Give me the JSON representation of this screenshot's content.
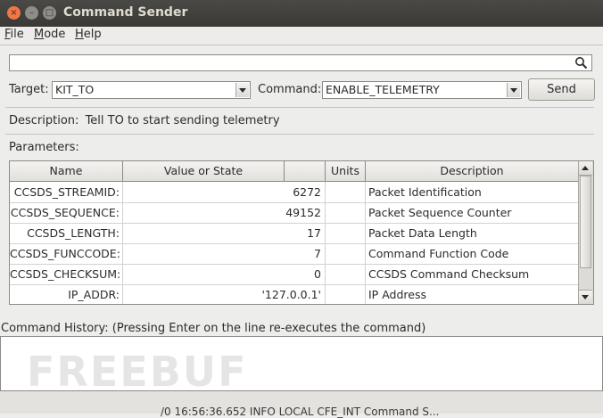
{
  "window": {
    "title": "Command Sender",
    "close_glyph": "×",
    "min_glyph": "–",
    "max_glyph": "□"
  },
  "menu": [
    {
      "key": "F",
      "rest": "ile"
    },
    {
      "key": "M",
      "rest": "ode"
    },
    {
      "key": "H",
      "rest": "elp"
    }
  ],
  "search": {
    "value": "",
    "icon": "search-icon"
  },
  "target": {
    "label": "Target:",
    "value": "KIT_TO"
  },
  "command": {
    "label": "Command:",
    "value": "ENABLE_TELEMETRY"
  },
  "send_label": "Send",
  "description": {
    "label": "Description:",
    "text": "Tell TO to start sending telemetry"
  },
  "parameters_label": "Parameters:",
  "table": {
    "headers": {
      "name": "Name",
      "value": "Value or State",
      "units": "Units",
      "description": "Description"
    },
    "rows": [
      {
        "name": "CCSDS_STREAMID:",
        "value": "6272",
        "units": "",
        "description": "Packet Identification"
      },
      {
        "name": "CCSDS_SEQUENCE:",
        "value": "49152",
        "units": "",
        "description": "Packet Sequence Counter"
      },
      {
        "name": "CCSDS_LENGTH:",
        "value": "17",
        "units": "",
        "description": "Packet Data Length"
      },
      {
        "name": "CCSDS_FUNCCODE:",
        "value": "7",
        "units": "",
        "description": "Command Function Code"
      },
      {
        "name": "CCSDS_CHECKSUM:",
        "value": "0",
        "units": "",
        "description": "CCSDS Command Checksum"
      },
      {
        "name": "IP_ADDR:",
        "value": "'127.0.0.1'",
        "units": "",
        "description": "IP Address"
      }
    ]
  },
  "history": {
    "label": "Command History: (Pressing Enter on the line re-executes the command)"
  },
  "watermark": "FREEBUF",
  "background_terminal": "/0 16:56:36.652  INFO  LOCAL  CFE_INT Command S..."
}
